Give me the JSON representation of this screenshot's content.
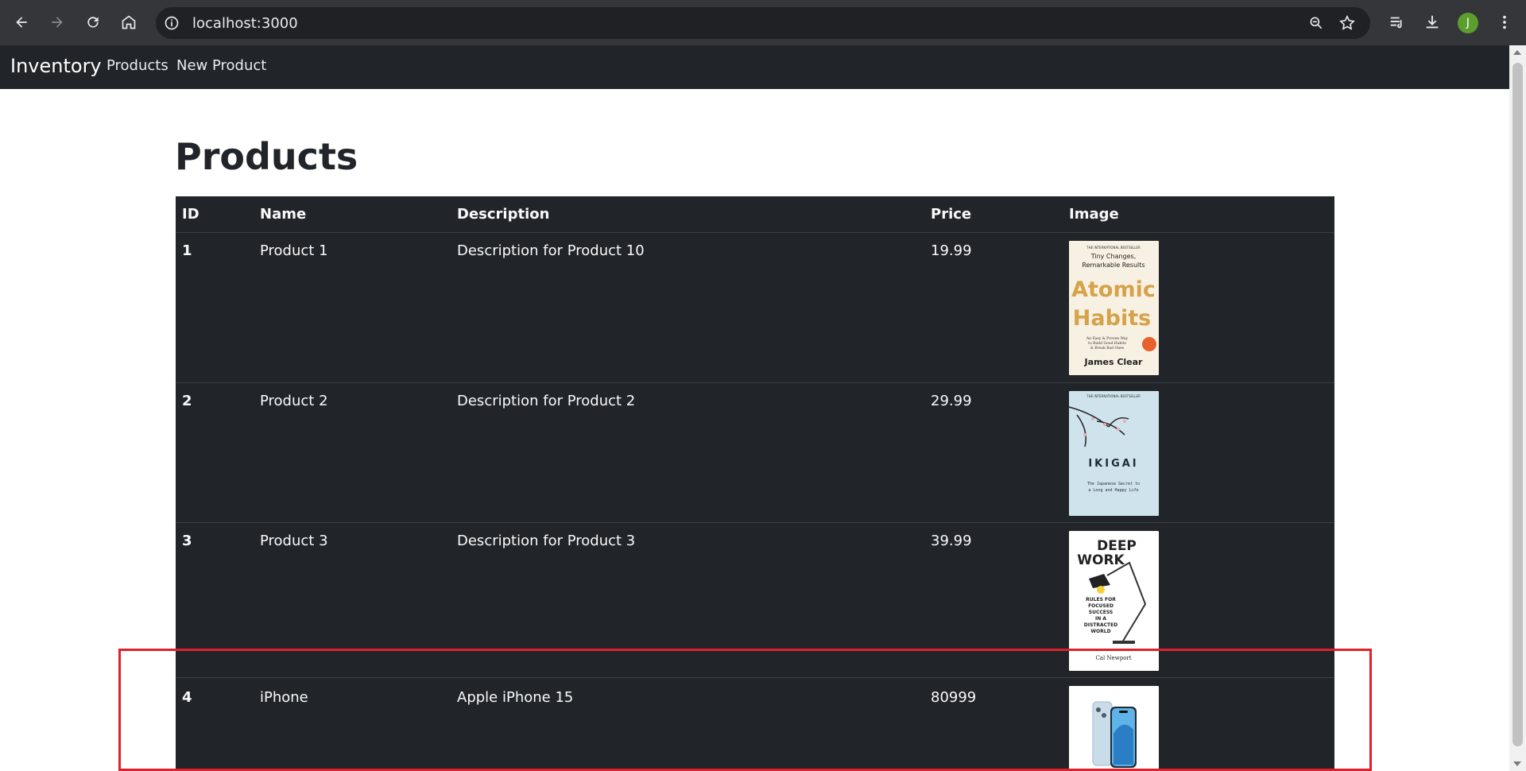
{
  "browser": {
    "url": "localhost:3000",
    "avatar_letter": "J"
  },
  "navbar": {
    "brand": "Inventory",
    "links": [
      "Products",
      "New Product"
    ]
  },
  "page": {
    "title": "Products"
  },
  "table": {
    "headers": [
      "ID",
      "Name",
      "Description",
      "Price",
      "Image"
    ],
    "rows": [
      {
        "id": "1",
        "name": "Product 1",
        "description": "Description for Product 10",
        "price": "19.99",
        "image": "atomic-habits-cover"
      },
      {
        "id": "2",
        "name": "Product 2",
        "description": "Description for Product 2",
        "price": "29.99",
        "image": "ikigai-cover"
      },
      {
        "id": "3",
        "name": "Product 3",
        "description": "Description for Product 3",
        "price": "39.99",
        "image": "deep-work-cover"
      },
      {
        "id": "4",
        "name": "iPhone",
        "description": "Apple iPhone 15",
        "price": "80999",
        "image": "iphone-15-photo"
      }
    ]
  },
  "covers": {
    "atomic": {
      "top1": "THE INTERNATIONAL BESTSELLER",
      "top2": "Tiny Changes,",
      "top3": "Remarkable Results",
      "title1": "Atomic",
      "title2": "Habits",
      "sub1": "An Easy & Proven Way",
      "sub2": "to Build Good Habits",
      "sub3": "& Break Bad Ones",
      "author": "James Clear"
    },
    "ikigai": {
      "top": "THE INTERNATIONAL BESTSELLER",
      "title": "IKIGAI",
      "sub1": "The Japanese Secret to",
      "sub2": "a Long and Happy Life"
    },
    "deep": {
      "title1": "DEEP",
      "title2": "WORK",
      "sub1": "RULES FOR",
      "sub2": "FOCUSED",
      "sub3": "SUCCESS",
      "sub4": "IN A",
      "sub5": "DISTRACTED",
      "sub6": "WORLD",
      "author": "Cal Newport"
    }
  },
  "colors": {
    "chrome": "#35363a",
    "navbar": "#212529",
    "table_bg": "#212529",
    "highlight": "#e0202a"
  }
}
